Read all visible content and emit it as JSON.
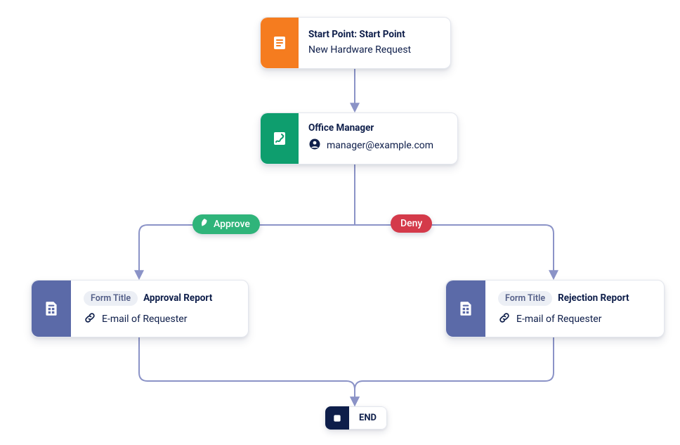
{
  "start": {
    "title": "Start Point: Start Point",
    "subtitle": "New Hardware Request"
  },
  "approver": {
    "title": "Office Manager",
    "email": "manager@example.com"
  },
  "decisions": {
    "approve_label": "Approve",
    "deny_label": "Deny"
  },
  "form_approve": {
    "pill": "Form Title",
    "title": "Approval Report",
    "field": "E-mail of Requester"
  },
  "form_deny": {
    "pill": "Form Title",
    "title": "Rejection Report",
    "field": "E-mail of Requester"
  },
  "end": {
    "label": "END"
  },
  "colors": {
    "start": "#f57c1f",
    "approver": "#0e9e6e",
    "form": "#5b6aa8",
    "approve": "#2fb47a",
    "deny": "#d43a4a",
    "end": "#0e1e4a",
    "connector": "#8b93c7"
  }
}
